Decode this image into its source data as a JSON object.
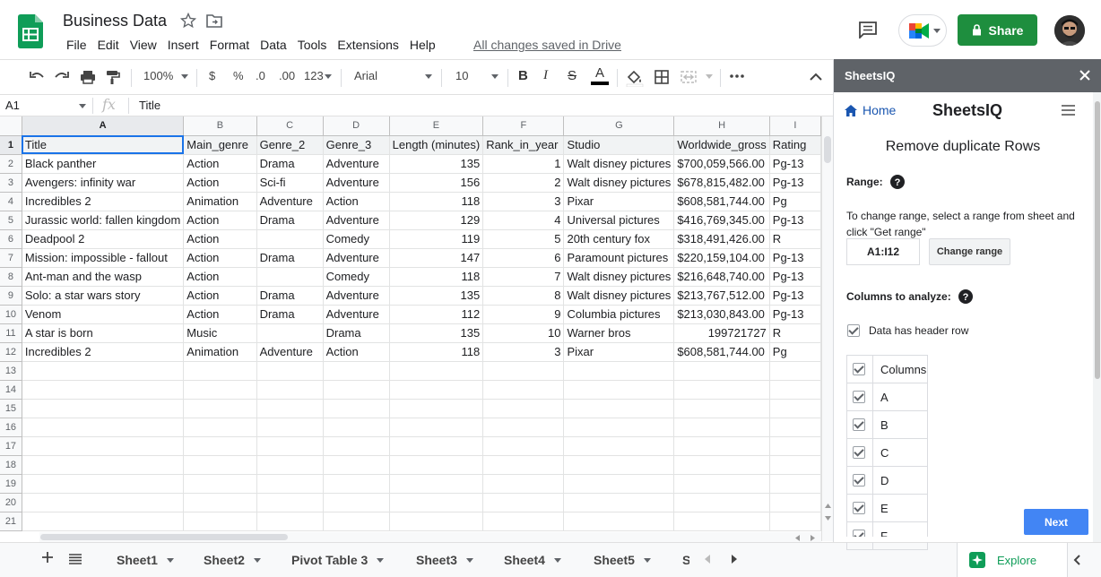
{
  "doc": {
    "title": "Business Data",
    "menu": [
      "File",
      "Edit",
      "View",
      "Insert",
      "Format",
      "Data",
      "Tools",
      "Extensions",
      "Help"
    ],
    "saved_status": "All changes saved in Drive",
    "share_label": "Share"
  },
  "toolbar": {
    "zoom": "100%",
    "currency": "$",
    "percent": "%",
    "dec_decrease": ".0",
    "dec_increase": ".00",
    "more_formats": "123",
    "font": "Arial",
    "font_size": "10",
    "bold": "B",
    "italic": "I",
    "strike": "S",
    "text_color": "A"
  },
  "formula": {
    "name_box": "A1",
    "fx": "fx",
    "value": "Title"
  },
  "grid": {
    "columns": [
      "A",
      "B",
      "C",
      "D",
      "E",
      "F",
      "G",
      "H",
      "I"
    ],
    "rows": [
      [
        "Title",
        "Main_genre",
        "Genre_2",
        "Genre_3",
        "Length (minutes)",
        "Rank_in_year",
        "Studio",
        "Worldwide_gross",
        "Rating"
      ],
      [
        "Black panther",
        "Action",
        "Drama",
        "Adventure",
        "135",
        "1",
        "Walt disney pictures",
        "$700,059,566.00",
        "Pg-13"
      ],
      [
        "Avengers: infinity war",
        "Action",
        "Sci-fi",
        "Adventure",
        "156",
        "2",
        "Walt disney pictures",
        "$678,815,482.00",
        "Pg-13"
      ],
      [
        "Incredibles 2",
        "Animation",
        "Adventure",
        "Action",
        "118",
        "3",
        "Pixar",
        "$608,581,744.00",
        "Pg"
      ],
      [
        "Jurassic world: fallen kingdom",
        "Action",
        "Drama",
        "Adventure",
        "129",
        "4",
        "Universal pictures",
        "$416,769,345.00",
        "Pg-13"
      ],
      [
        "Deadpool 2",
        "Action",
        "",
        "Comedy",
        "119",
        "5",
        "20th century fox",
        "$318,491,426.00",
        "R"
      ],
      [
        "Mission: impossible - fallout",
        "Action",
        "Drama",
        "Adventure",
        "147",
        "6",
        "Paramount pictures",
        "$220,159,104.00",
        "Pg-13"
      ],
      [
        "Ant-man and the wasp",
        "Action",
        "",
        "Comedy",
        "118",
        "7",
        "Walt disney pictures",
        "$216,648,740.00",
        "Pg-13"
      ],
      [
        "Solo: a star wars story",
        "Action",
        "Drama",
        "Adventure",
        "135",
        "8",
        "Walt disney pictures",
        "$213,767,512.00",
        "Pg-13"
      ],
      [
        "Venom",
        "Action",
        "Drama",
        "Adventure",
        "112",
        "9",
        "Columbia pictures",
        "$213,030,843.00",
        "Pg-13"
      ],
      [
        "A star is born",
        "Music",
        "",
        "Drama",
        "135",
        "10",
        "Warner bros",
        "199721727",
        "R"
      ],
      [
        "Incredibles 2",
        "Animation",
        "Adventure",
        "Action",
        "118",
        "3",
        "Pixar",
        "$608,581,744.00",
        "Pg"
      ]
    ],
    "row_numbers": [
      "1",
      "2",
      "3",
      "4",
      "5",
      "6",
      "7",
      "8",
      "9",
      "10",
      "11",
      "12",
      "13",
      "14",
      "15",
      "16",
      "17",
      "18",
      "19",
      "20",
      "21"
    ]
  },
  "tabs": {
    "sheets": [
      "Sheet1",
      "Sheet2",
      "Pivot Table 3",
      "Sheet3",
      "Sheet4",
      "Sheet5",
      "S"
    ],
    "explore": "Explore"
  },
  "panel": {
    "title": "SheetsIQ",
    "home": "Home",
    "brand": "SheetsIQ",
    "heading": "Remove duplicate Rows",
    "range_label": "Range:",
    "range_help": "To change range, select a range from sheet and click \"Get range\"",
    "range_value": "A1:I12",
    "change_range": "Change range",
    "columns_label": "Columns to analyze:",
    "header_row": "Data has header row",
    "columns_header": "Columns",
    "columns": [
      "A",
      "B",
      "C",
      "D",
      "E",
      "F"
    ],
    "next": "Next"
  }
}
